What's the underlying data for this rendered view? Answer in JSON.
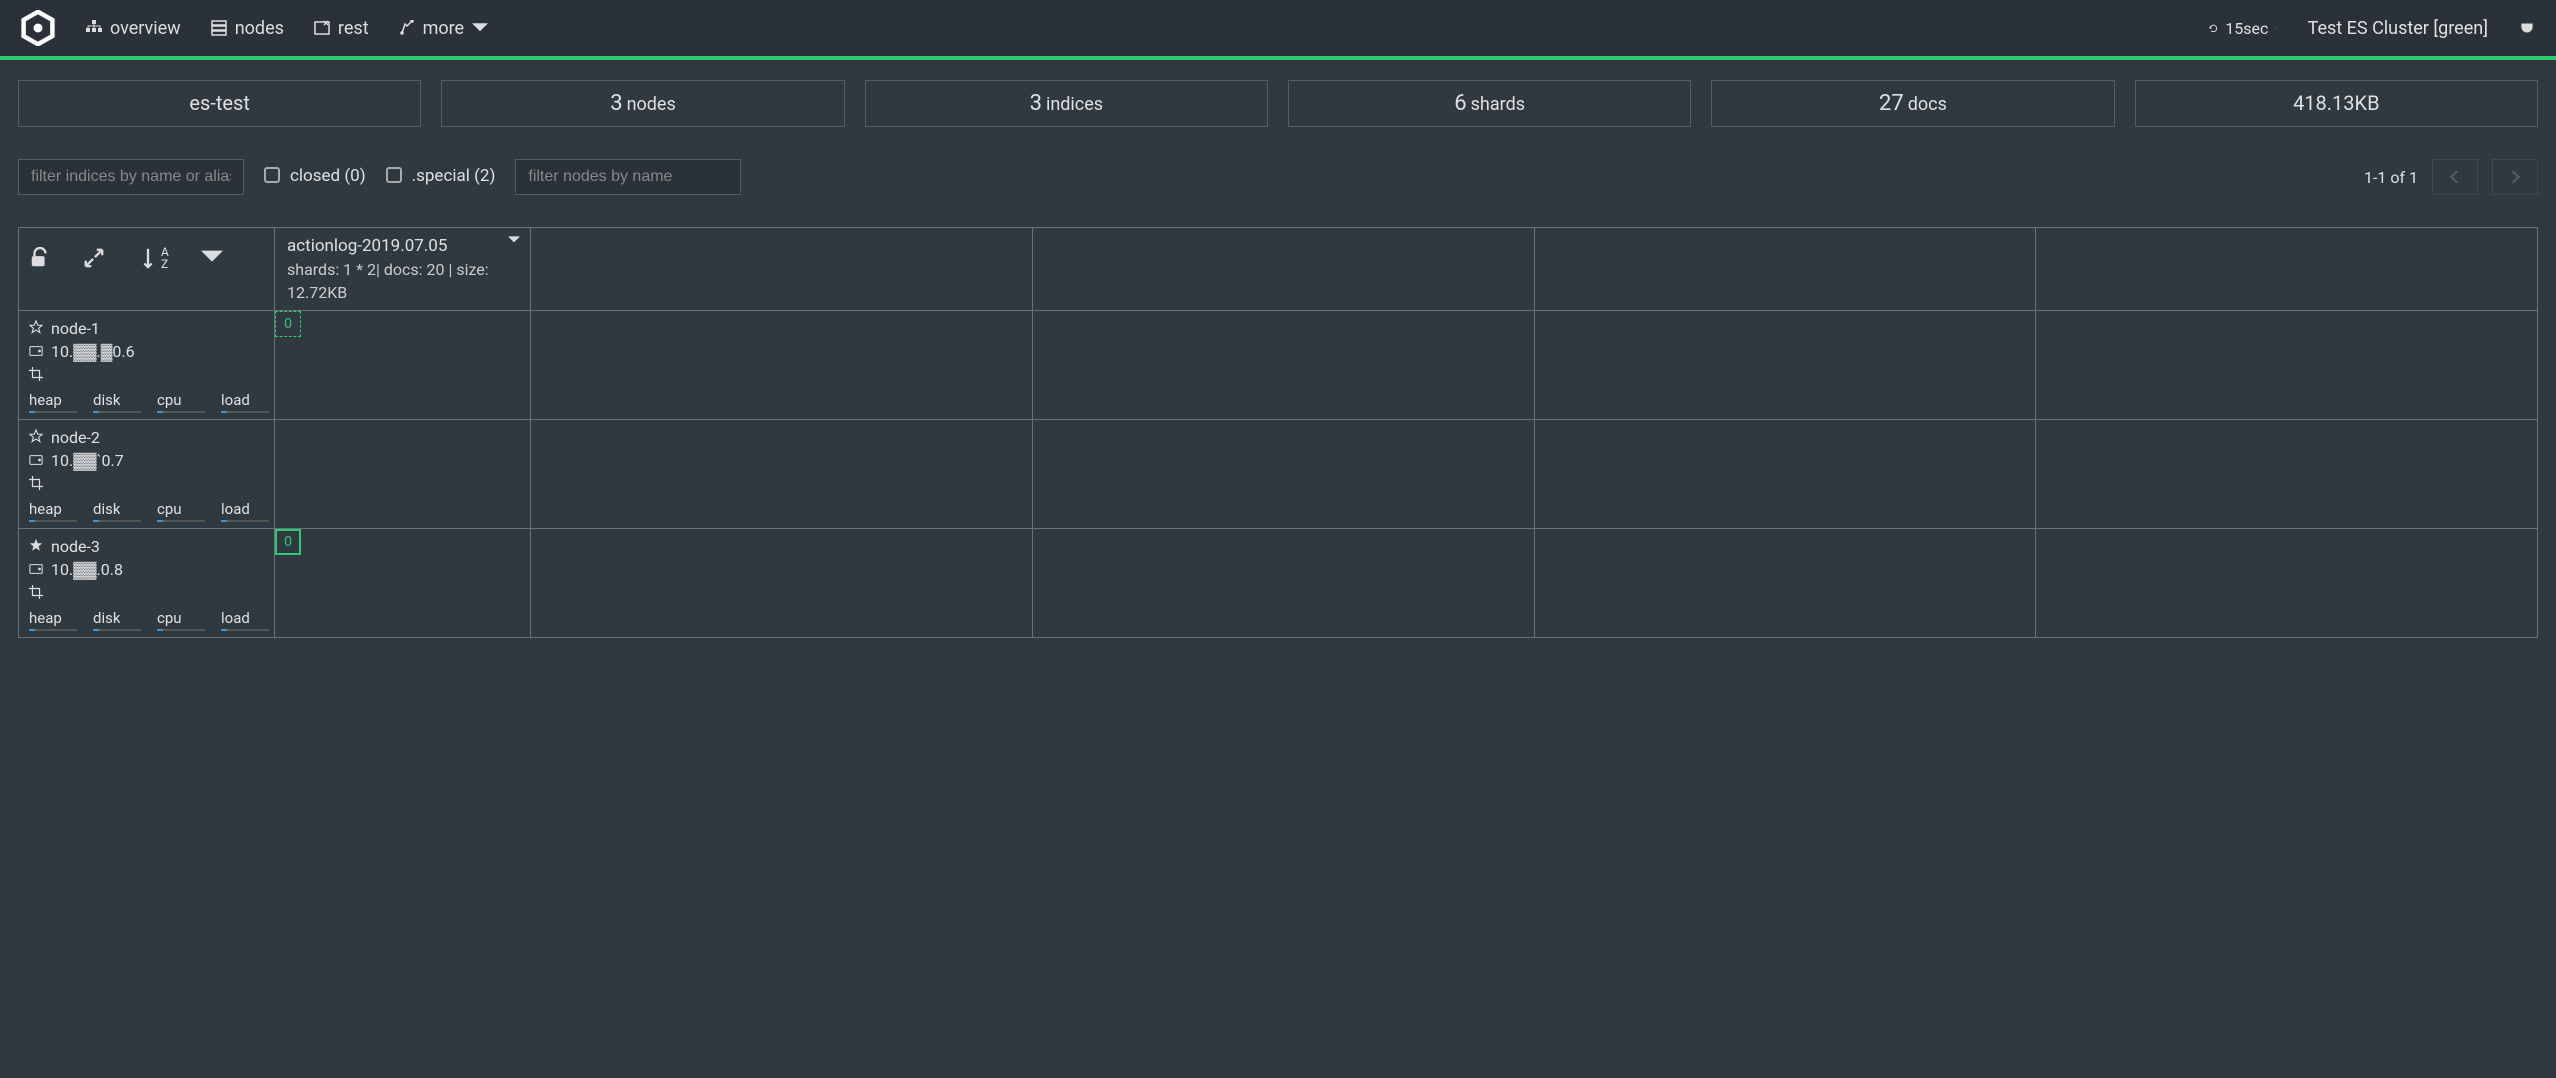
{
  "nav": {
    "overview": "overview",
    "nodes": "nodes",
    "rest": "rest",
    "more": "more",
    "refresh_interval": "15sec",
    "cluster_status": "Test ES Cluster [green]"
  },
  "stats": {
    "cluster_name": "es-test",
    "nodes_count": "3",
    "nodes_label": "nodes",
    "indices_count": "3",
    "indices_label": "indices",
    "shards_count": "6",
    "shards_label": "shards",
    "docs_count": "27",
    "docs_label": "docs",
    "size": "418.13KB"
  },
  "filters": {
    "index_placeholder": "filter indices by name or alias",
    "closed_label": "closed (0)",
    "special_label": ".special (2)",
    "node_placeholder": "filter nodes by name",
    "pagination": "1-1 of 1"
  },
  "index": {
    "name": "actionlog-2019.07.05",
    "meta1": "shards: 1 * 2| docs: 20 | size:",
    "meta2": "12.72KB"
  },
  "nodes": [
    {
      "name": "node-1",
      "ip": "10.▓▓.▓0.6",
      "master": false,
      "shard": {
        "id": "0",
        "type": "replica"
      },
      "metrics": [
        "heap",
        "disk",
        "cpu",
        "load"
      ]
    },
    {
      "name": "node-2",
      "ip": "10.▓▓`0.7",
      "master": false,
      "shard": null,
      "metrics": [
        "heap",
        "disk",
        "cpu",
        "load"
      ]
    },
    {
      "name": "node-3",
      "ip": "10.▓▓.0.8",
      "master": true,
      "shard": {
        "id": "0",
        "type": "primary"
      },
      "metrics": [
        "heap",
        "disk",
        "cpu",
        "load"
      ]
    }
  ]
}
